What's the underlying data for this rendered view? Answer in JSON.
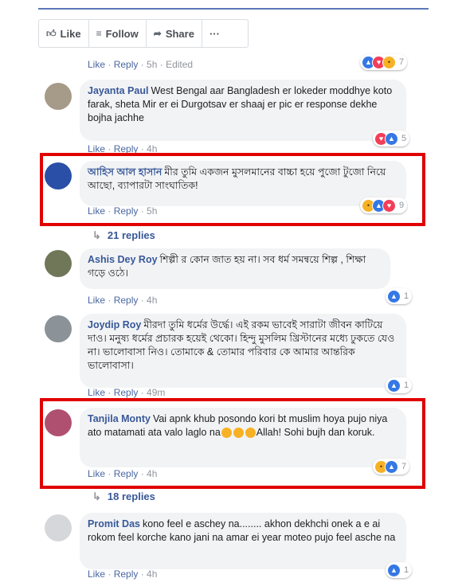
{
  "actions": {
    "like": "Like",
    "follow": "Follow",
    "share": "Share",
    "more": "···"
  },
  "comments": [
    {
      "meta_like": "Like",
      "meta_reply": "Reply",
      "meta_time": "5h",
      "meta_edited": "Edited",
      "reactions_count": "7"
    },
    {
      "name": "Jayanta Paul",
      "text": "West Bengal aar Bangladesh er lokeder moddhye koto farak, sheta Mir er ei Durgotsav er shaaj er pic er response dekhe bojha jachhe",
      "meta_like": "Like",
      "meta_reply": "Reply",
      "meta_time": "4h",
      "reactions_count": "5"
    },
    {
      "name": "আহিস আল হাসান",
      "text": "মীর তুমি একজন মুসলমানের বাচ্চা হয়ে পুজো টুজো নিয়ে আছো, ব্যাপারটা সাংঘাতিক!",
      "meta_like": "Like",
      "meta_reply": "Reply",
      "meta_time": "5h",
      "reactions_count": "9",
      "replies": "21 replies"
    },
    {
      "name": "Ashis Dey Roy",
      "text": "শিল্পী র কোন জাত হয় না। সব ধর্ম সমন্বয়ে শিল্প , শিক্ষা গড়ে ওঠে।",
      "meta_like": "Like",
      "meta_reply": "Reply",
      "meta_time": "4h",
      "reactions_count": "1"
    },
    {
      "name": "Joydip Roy",
      "text": "মীরদা তুমি ধর্মের উর্দ্ধে। এই রকম ভাবেই সারাটা জীবন কাটিয়ে দাও। মনুষ্য ধর্মের প্রচারক হয়েই থেকো। হিন্দু মুসলিম খ্রিস্টানের মধ্যে ঢুকতে যেও না। ভালোবাসা নিও। তোমাকে & তোমার পরিবার কে আমার আন্তরিক ভালোবাসা।",
      "meta_like": "Like",
      "meta_reply": "Reply",
      "meta_time": "49m",
      "reactions_count": "1"
    },
    {
      "name": "Tanjila Monty",
      "text_a": "Vai apnk khub posondo kori bt muslim hoya pujo niya ato matamati ata valo laglo na",
      "text_b": "Allah! Sohi bujh dan koruk.",
      "meta_like": "Like",
      "meta_reply": "Reply",
      "meta_time": "4h",
      "reactions_count": "7",
      "replies": "18 replies"
    },
    {
      "name": "Promit Das",
      "text": "kono feel e aschey na........ akhon dekhchi onek a e ai rokom feel korche kano jani na amar ei year moteo pujo feel asche na",
      "meta_like": "Like",
      "meta_reply": "Reply",
      "meta_time": "4h",
      "reactions_count": "1"
    }
  ],
  "icons": [
    "like-icon",
    "rss-follow-icon",
    "share-arrow-icon",
    "more-icon",
    "reply-arrow-icon",
    "avatar",
    "reaction-like-icon",
    "reaction-love-icon",
    "reaction-haha-icon",
    "reaction-wow-icon",
    "reaction-sad-icon",
    "sad-emoji-icon"
  ],
  "colors": {
    "highlight_border": "#e00000",
    "name_link": "#385898",
    "bubble_bg": "#f2f3f5",
    "meta_text": "#90949c",
    "like_blue": "#3578e5",
    "love_red": "#f33e58"
  }
}
